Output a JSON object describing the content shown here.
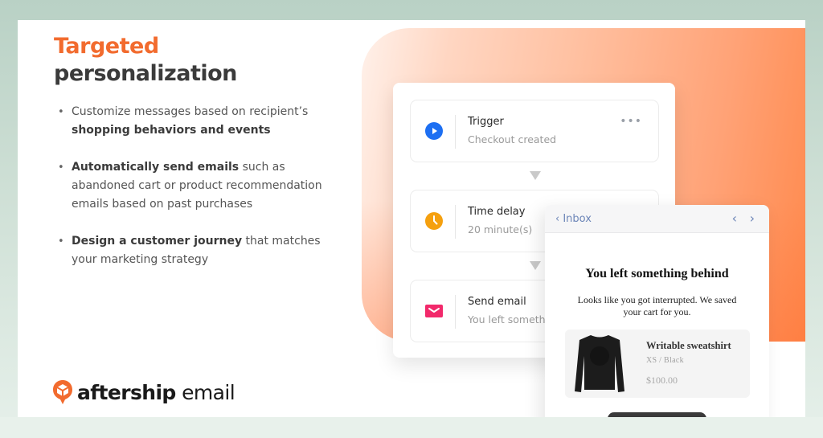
{
  "headline": {
    "line1": "Targeted",
    "line2": "personalization"
  },
  "bullets": [
    {
      "pre": "Customize messages based on recipient’s ",
      "bold": "shopping behaviors and events",
      "post": ""
    },
    {
      "pre": "",
      "bold": "Automatically send emails",
      "post": " such as abandoned cart or product recommendation emails based on past purchases"
    },
    {
      "pre": "",
      "bold": "Design a customer journey",
      "post": " that matches your marketing strategy"
    }
  ],
  "logo": {
    "brand": "aftership",
    "product": "email",
    "icon": "aftership-box-pin-icon"
  },
  "colors": {
    "accent_orange": "#f26b2e",
    "heading_dark": "#3b3b3b",
    "trigger_blue": "#1d6ff2",
    "delay_orange": "#f5a00f",
    "email_pink": "#f2296b",
    "inbox_link": "#6d86b8"
  },
  "flow": {
    "steps": [
      {
        "title": "Trigger",
        "subtitle": "Checkout created",
        "icon": "play-circle-icon",
        "menu": "•••"
      },
      {
        "title": "Time delay",
        "subtitle": "20 minute(s)",
        "icon": "clock-icon"
      },
      {
        "title": "Send email",
        "subtitle": "You left something behind",
        "icon": "envelope-icon"
      }
    ]
  },
  "email": {
    "back_label": "‹ Inbox",
    "prev": "‹",
    "next": "›",
    "title": "You left something behind",
    "body": "Looks like you got interrupted. We saved your cart for you.",
    "product": {
      "name": "Writable sweatshirt",
      "variant": "XS / Black",
      "price": "$100.00"
    }
  }
}
